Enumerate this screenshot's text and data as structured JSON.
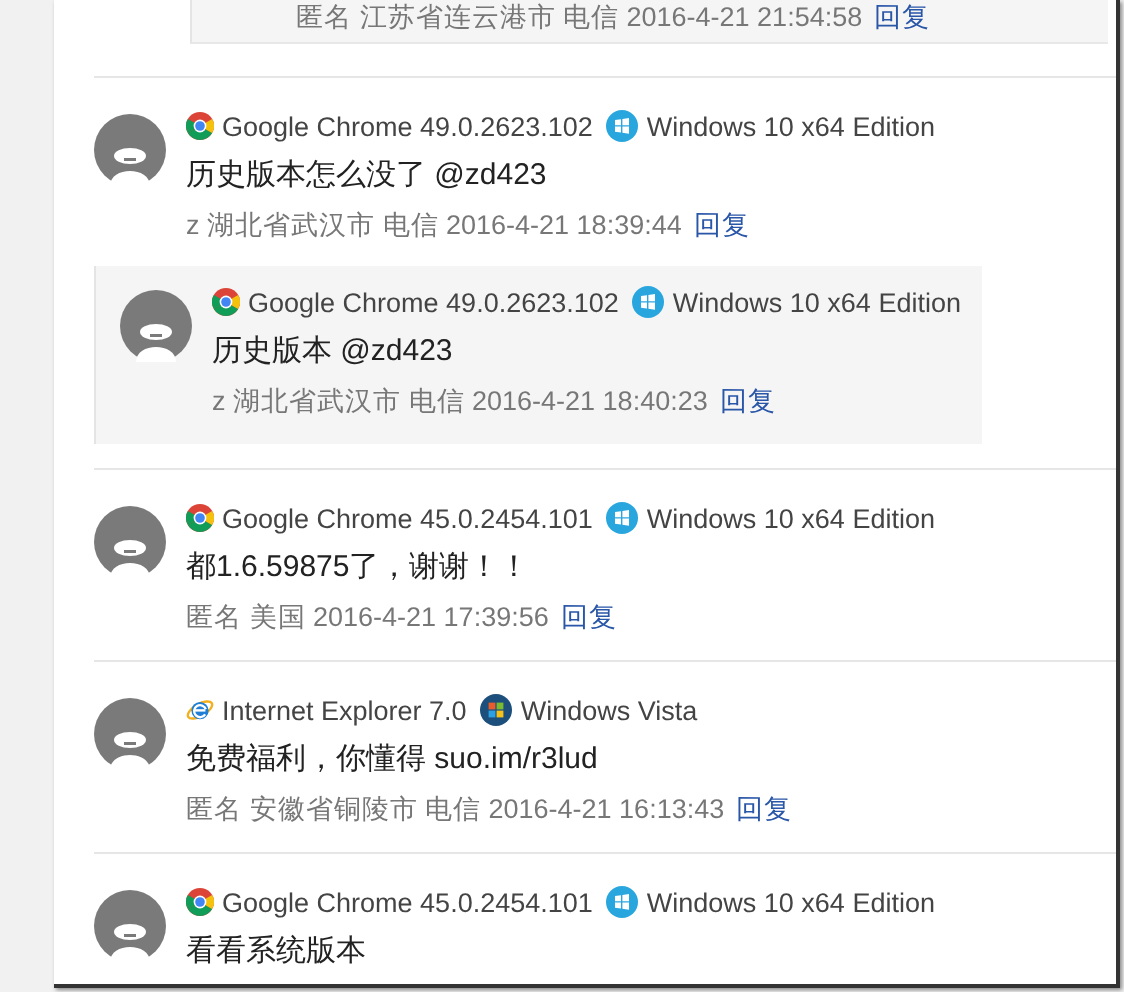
{
  "partial_reply": {
    "meta": "匿名 江苏省连云港市 电信 2016-4-21 21:54:58",
    "reply_link": "回复"
  },
  "comments": [
    {
      "browser": {
        "kind": "chrome",
        "name": "Google Chrome 49.0.2623.102"
      },
      "os": {
        "kind": "windows10",
        "name": "Windows 10 x64 Edition"
      },
      "text": "历史版本怎么没了 @zd423",
      "meta": "z 湖北省武汉市 电信 2016-4-21 18:39:44",
      "reply_link": "回复",
      "replies": [
        {
          "browser": {
            "kind": "chrome",
            "name": "Google Chrome 49.0.2623.102"
          },
          "os": {
            "kind": "windows10",
            "name": "Windows 10 x64 Edition"
          },
          "text": "历史版本 @zd423",
          "meta": "z 湖北省武汉市 电信 2016-4-21 18:40:23",
          "reply_link": "回复"
        }
      ]
    },
    {
      "browser": {
        "kind": "chrome",
        "name": "Google Chrome 45.0.2454.101"
      },
      "os": {
        "kind": "windows10",
        "name": "Windows 10 x64 Edition"
      },
      "text": "都1.6.59875了，谢谢！！",
      "meta": "匿名 美国 2016-4-21 17:39:56",
      "reply_link": "回复"
    },
    {
      "browser": {
        "kind": "ie",
        "name": "Internet Explorer 7.0"
      },
      "os": {
        "kind": "vista",
        "name": "Windows Vista"
      },
      "text": "免费福利，你懂得 suo.im/r3lud",
      "meta": "匿名 安徽省铜陵市 电信 2016-4-21 16:13:43",
      "reply_link": "回复"
    },
    {
      "browser": {
        "kind": "chrome",
        "name": "Google Chrome 45.0.2454.101"
      },
      "os": {
        "kind": "windows10",
        "name": "Windows 10 x64 Edition"
      },
      "text": "看看系统版本"
    }
  ]
}
